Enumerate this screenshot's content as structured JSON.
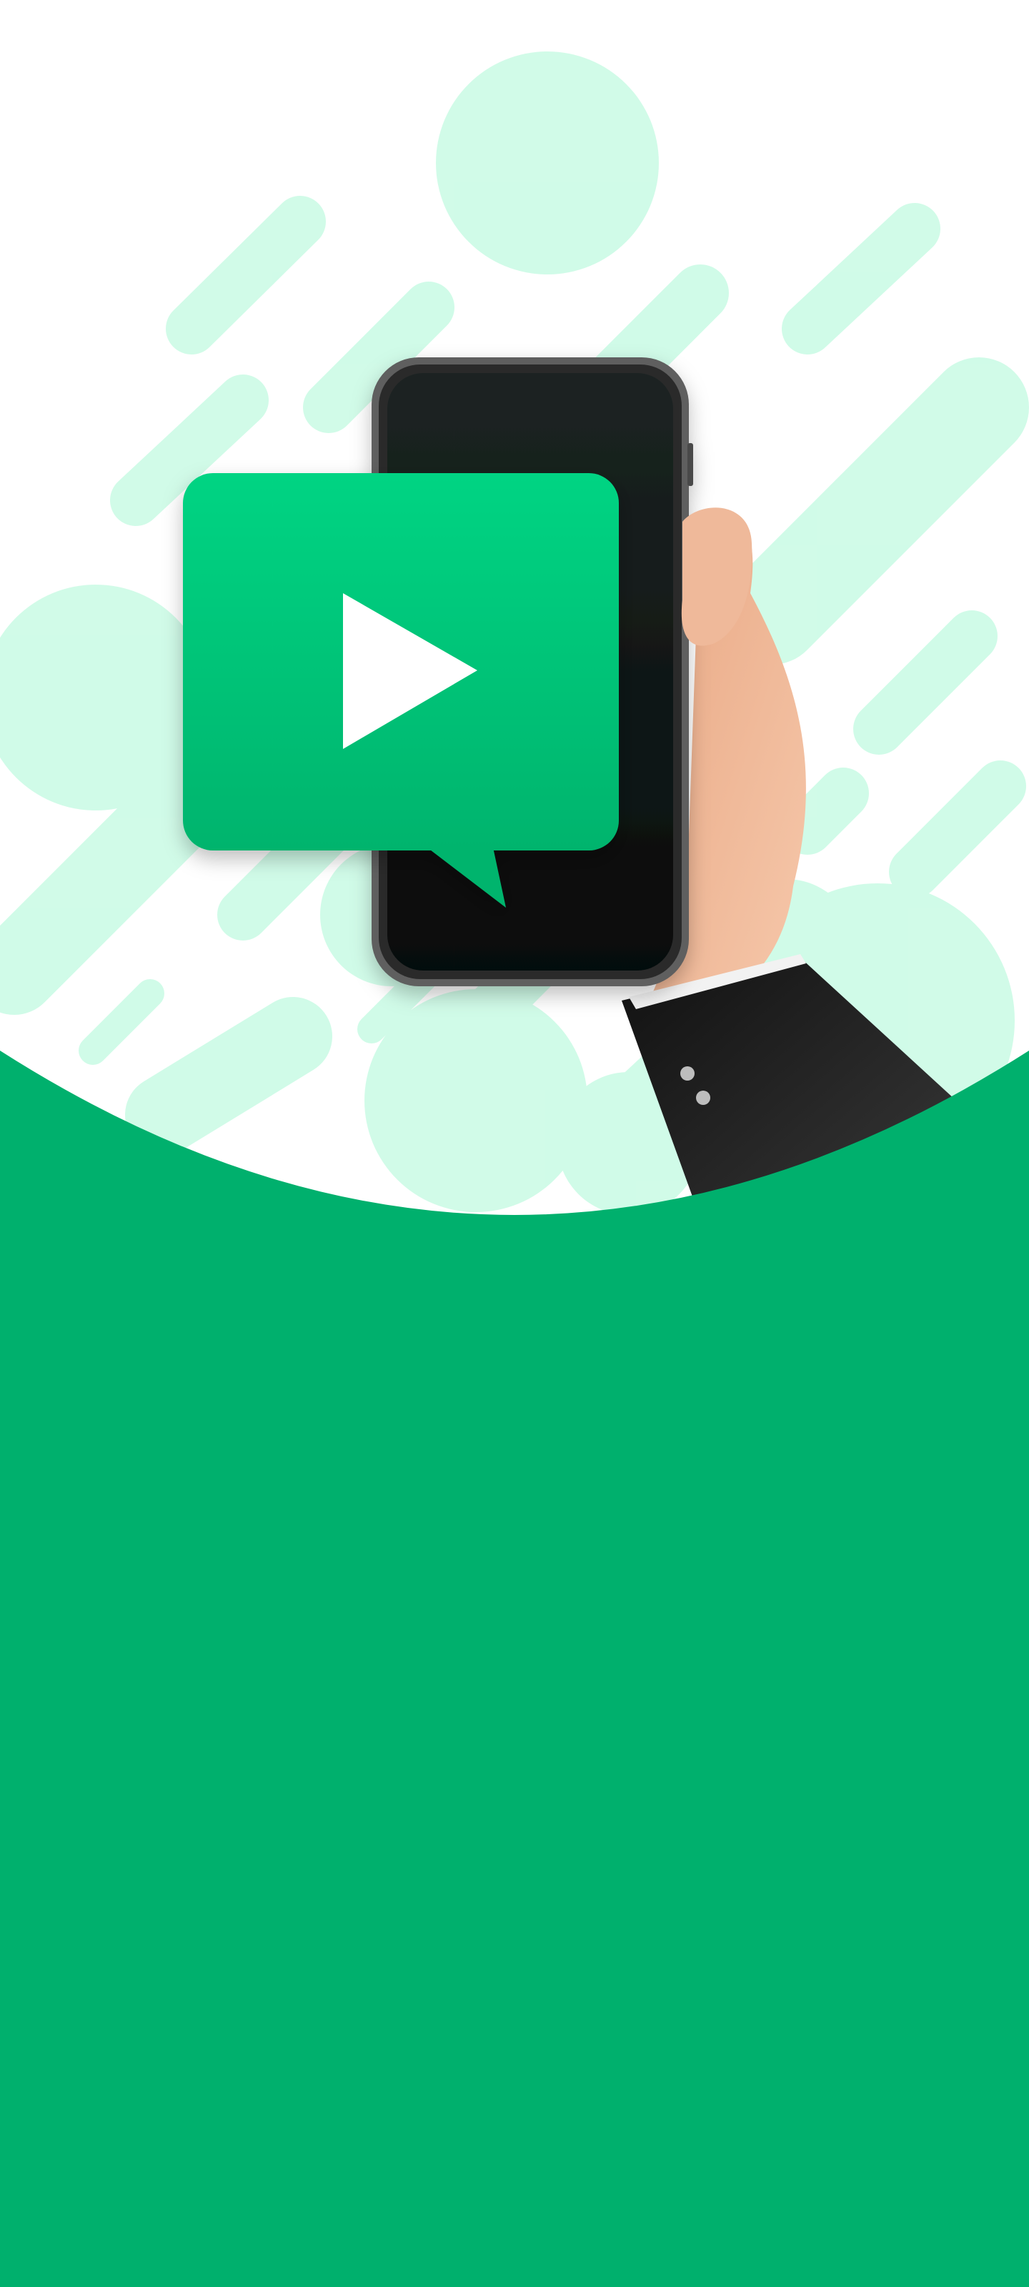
{
  "app": {
    "screen": "video-onboarding"
  },
  "colors": {
    "accent_green": "#00b06d",
    "light_mint": "#d2fbe9",
    "bubble_top": "#00d483",
    "bubble_bottom": "#00b46d",
    "phone_body": "#141818",
    "phone_frame": "#6b6b6b",
    "skin": "#efb99a",
    "sleeve": "#2a2a2a",
    "play_icon": "#ffffff"
  },
  "illustration": {
    "icon": "play-icon",
    "subject": "hand-holding-phone-icon",
    "bubble": "video-chat-bubble-icon"
  }
}
